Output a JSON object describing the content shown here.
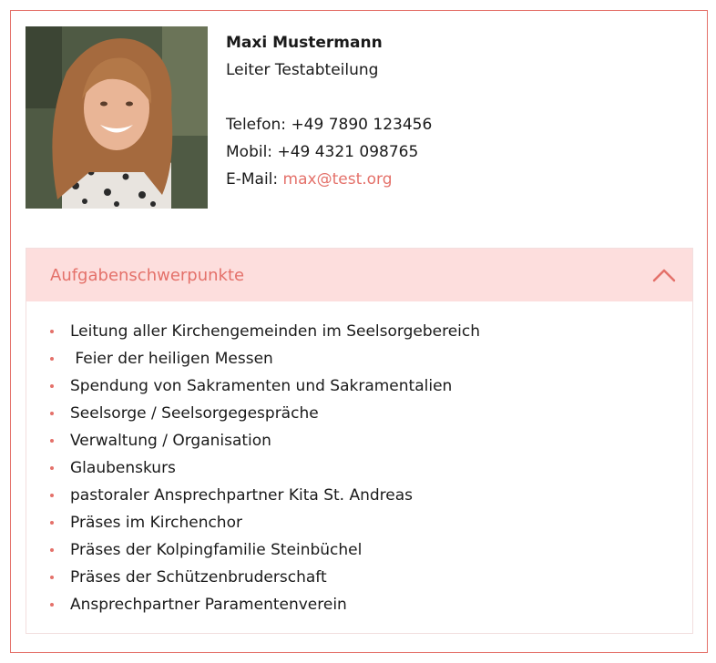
{
  "contact": {
    "name": "Maxi Mustermann",
    "role": "Leiter Testabteilung",
    "phone_label": "Telefon:",
    "phone": "+49 7890 123456",
    "mobile_label": "Mobil:",
    "mobile": "+49 4321 098765",
    "email_label": "E-Mail:",
    "email": "max@test.org"
  },
  "accordion": {
    "title": "Aufgabenschwerpunkte",
    "expanded": true,
    "items": [
      "Leitung aller Kirchengemeinden im Seelsorgebereich",
      " Feier der heiligen Messen",
      "Spendung von Sakramenten und Sakramentalien",
      "Seelsorge / Seelsorgegespräche",
      "Verwaltung / Organisation",
      "Glaubenskurs",
      "pastoraler Ansprechpartner Kita St. Andreas",
      "Präses im Kirchenchor",
      "Präses der Kolpingfamilie Steinbüchel",
      "Präses der Schützenbruderschaft",
      "Ansprechpartner Paramentenverein"
    ]
  },
  "colors": {
    "accent": "#e4716a",
    "header_bg": "#fddedd",
    "border": "#e4716a"
  },
  "icons": {
    "accordion_toggle": "chevron-up-icon"
  }
}
